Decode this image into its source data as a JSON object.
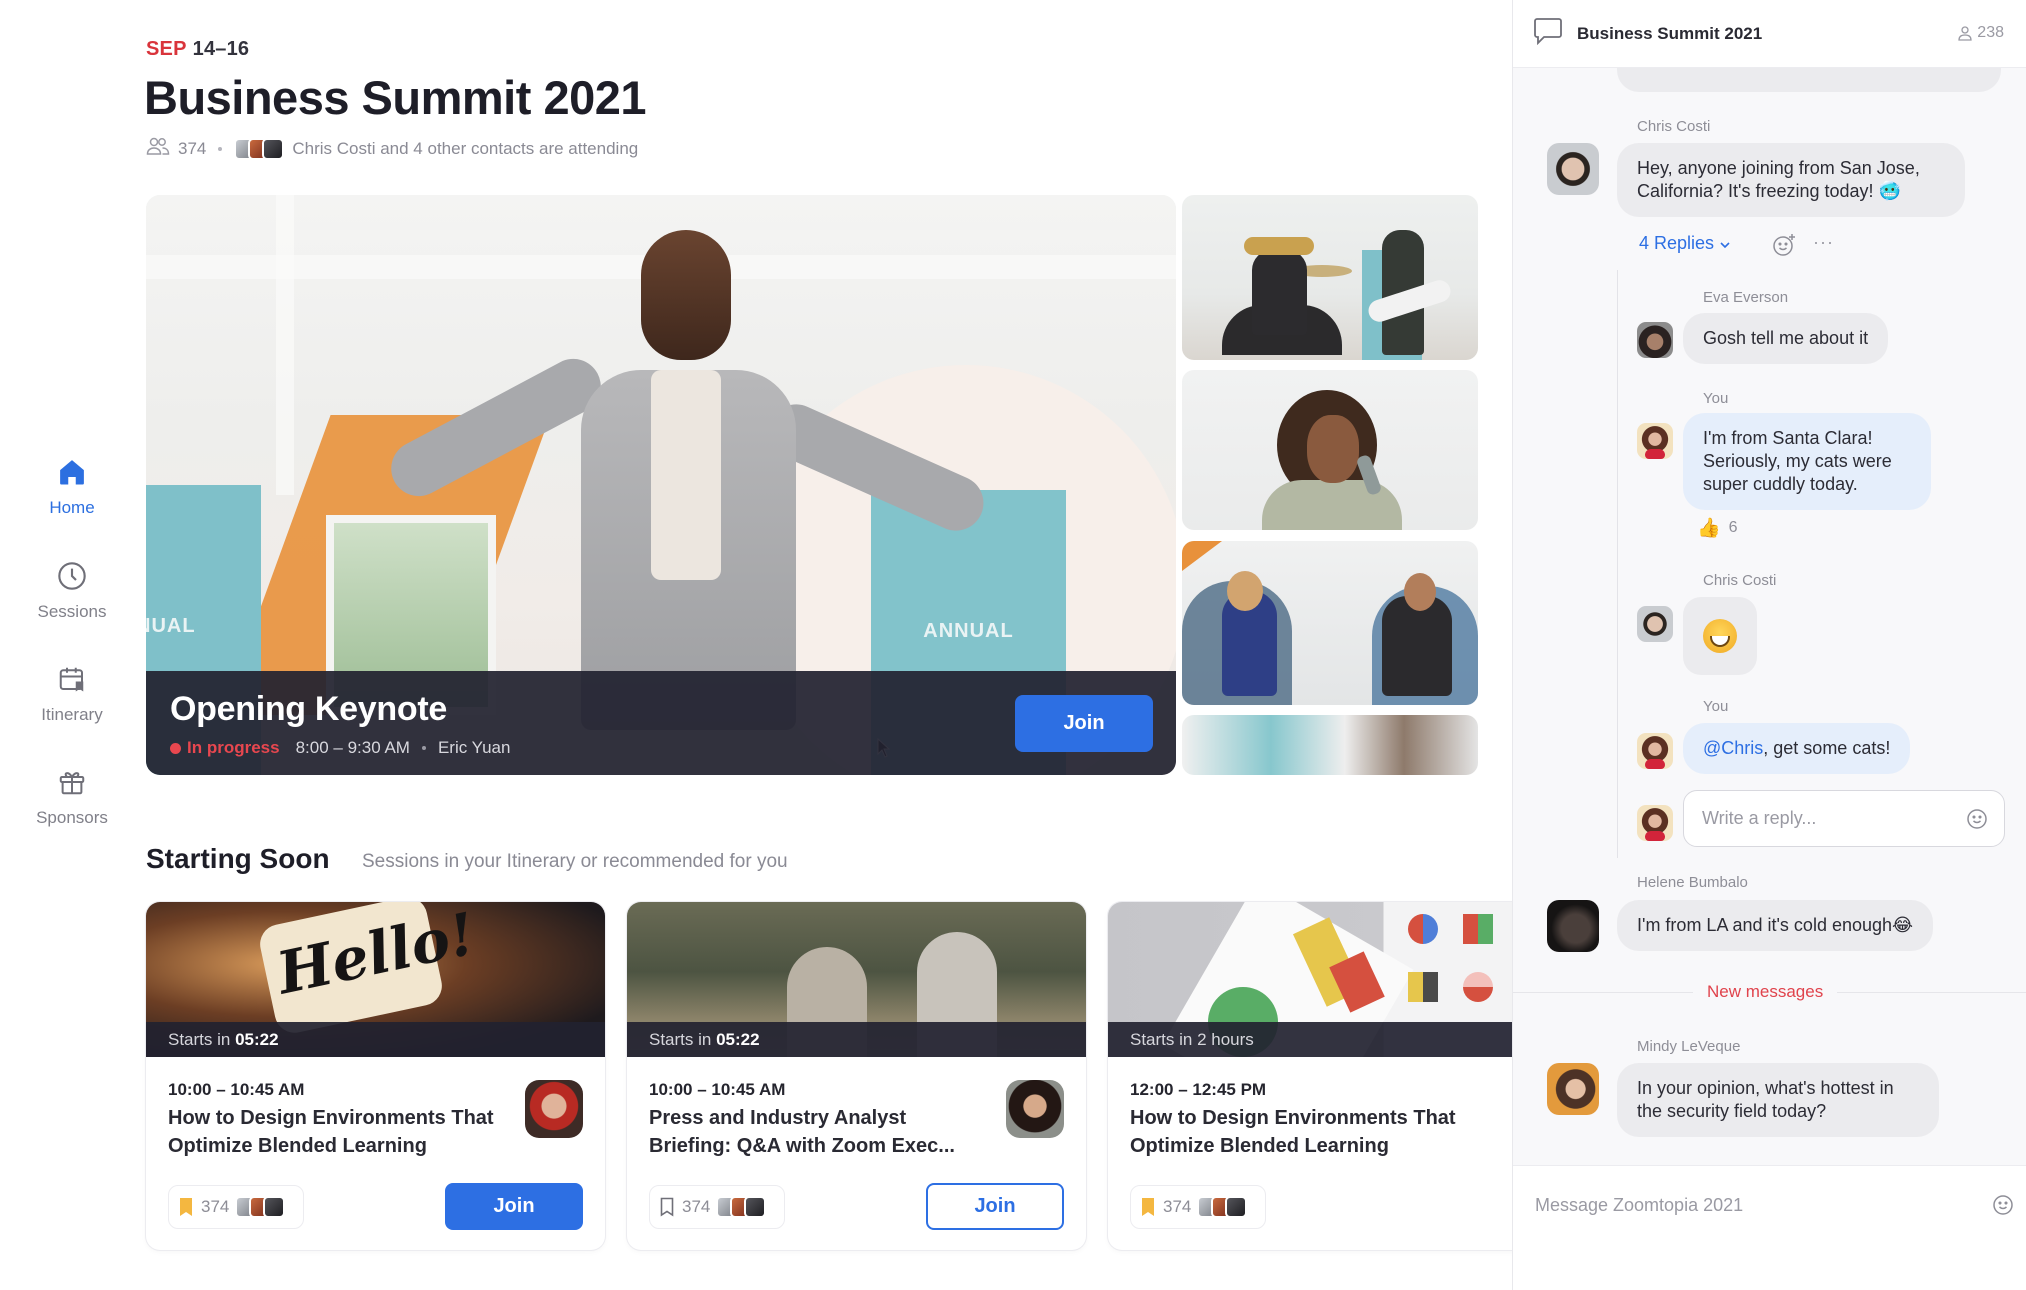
{
  "sidebar": {
    "items": [
      {
        "label": "Home",
        "icon": "home-icon",
        "active": true
      },
      {
        "label": "Sessions",
        "icon": "clock-icon",
        "active": false
      },
      {
        "label": "Itinerary",
        "icon": "calendar-bookmark-icon",
        "active": false
      },
      {
        "label": "Sponsors",
        "icon": "gift-icon",
        "active": false
      }
    ]
  },
  "event": {
    "month": "SEP",
    "days": "14–16",
    "title": "Business Summit 2021",
    "attendee_count": "374",
    "attending_text": "Chris Costi and 4 other contacts are attending"
  },
  "keynote": {
    "title": "Opening Keynote",
    "status": "In progress",
    "time": "8:00 – 9:30 AM",
    "speaker": "Eric Yuan",
    "join_label": "Join",
    "banner_left_text": "NUAL",
    "banner_right_text": "ANNUAL"
  },
  "starting_soon": {
    "title": "Starting Soon",
    "subtitle": "Sessions in your Itinerary or recommended for you",
    "cards": [
      {
        "starts_prefix": "Starts in ",
        "starts_value": "05:22",
        "time": "10:00 – 10:45 AM",
        "title": "How to Design Environments That Optimize Blended Learning",
        "count": "374",
        "bookmarked": true,
        "join_label": "Join",
        "join_style": "primary",
        "image_text": "Hello!"
      },
      {
        "starts_prefix": "Starts in ",
        "starts_value": "05:22",
        "time": "10:00 – 10:45 AM",
        "title": "Press and Industry Analyst Briefing: Q&A with Zoom Exec...",
        "count": "374",
        "bookmarked": false,
        "join_label": "Join",
        "join_style": "outline"
      },
      {
        "starts_prefix": "Starts in 2 hours",
        "starts_value": "",
        "time": "12:00 – 12:45 PM",
        "title": "How to Design Environments That Optimize Blended Learning",
        "count": "374",
        "bookmarked": true
      }
    ]
  },
  "chat": {
    "title": "Business Summit 2021",
    "member_count": "238",
    "messages": [
      {
        "author": "Chris Costi",
        "text": "Hey, anyone joining from San Jose, California? It's freezing today! 🥶"
      },
      {
        "author": "Eva Everson",
        "text": "Gosh tell me about it"
      },
      {
        "author": "You",
        "text": "I'm from Santa Clara! Seriously, my cats were super cuddly today."
      },
      {
        "author": "Chris Costi",
        "text": "😁"
      },
      {
        "author": "You",
        "mention": "@Chris",
        "text": ", get some cats!"
      },
      {
        "author": "Helene Bumbalo",
        "text": "I'm from LA and it's cold enough😂"
      },
      {
        "author": "Mindy LeVeque",
        "text": "In your opinion, what's hottest in the security field today?"
      }
    ],
    "replies_label": "4 Replies",
    "more_label": "···",
    "like_count": "6",
    "reply_placeholder": "Write a reply...",
    "new_messages_label": "New messages",
    "composer_placeholder": "Message Zoomtopia 2021"
  },
  "colors": {
    "accent": "#2d6fe3",
    "live": "#e8474f",
    "month": "#d9343b",
    "bookmark": "#f4b740"
  }
}
